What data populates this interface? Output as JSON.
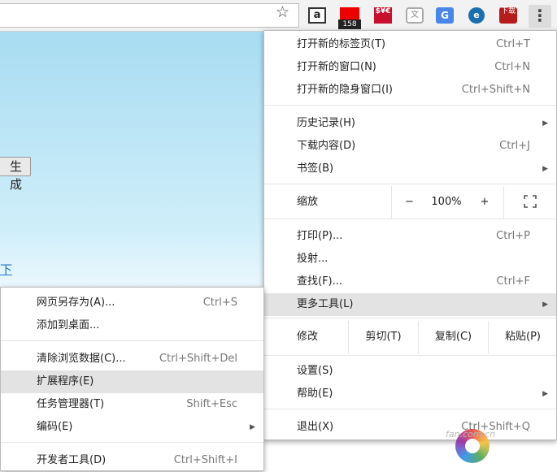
{
  "toolbar": {
    "star_icon": "star-icon",
    "extensions": [
      {
        "name": "amazon-icon",
        "glyph": "a"
      },
      {
        "name": "red-flag-icon",
        "badge": "158"
      },
      {
        "name": "currency-exchange-icon",
        "glyph": "$¥€"
      },
      {
        "name": "shield-icon",
        "glyph": "文"
      },
      {
        "name": "translate-icon",
        "glyph": "G"
      },
      {
        "name": "e-icon",
        "glyph": "e"
      },
      {
        "name": "tv-download-icon",
        "glyph": "下载"
      }
    ],
    "menu_glyph": "⋮"
  },
  "page": {
    "button_text": "生 成",
    "link_text": "下"
  },
  "main_menu": {
    "new_tab": {
      "label": "打开新的标签页(T)",
      "shortcut": "Ctrl+T"
    },
    "new_window": {
      "label": "打开新的窗口(N)",
      "shortcut": "Ctrl+N"
    },
    "incognito": {
      "label": "打开新的隐身窗口(I)",
      "shortcut": "Ctrl+Shift+N"
    },
    "history": {
      "label": "历史记录(H)"
    },
    "downloads": {
      "label": "下载内容(D)",
      "shortcut": "Ctrl+J"
    },
    "bookmarks": {
      "label": "书签(B)"
    },
    "zoom": {
      "label": "缩放",
      "minus": "−",
      "value": "100%",
      "plus": "+"
    },
    "print": {
      "label": "打印(P)...",
      "shortcut": "Ctrl+P"
    },
    "cast": {
      "label": "投射..."
    },
    "find": {
      "label": "查找(F)...",
      "shortcut": "Ctrl+F"
    },
    "more_tools": {
      "label": "更多工具(L)"
    },
    "edit": {
      "label": "修改",
      "cut": "剪切(T)",
      "copy": "复制(C)",
      "paste": "粘贴(P)"
    },
    "settings": {
      "label": "设置(S)"
    },
    "help": {
      "label": "帮助(E)"
    },
    "exit": {
      "label": "退出(X)",
      "shortcut": "Ctrl+Shift+Q"
    }
  },
  "sub_menu": {
    "save_as": {
      "label": "网页另存为(A)...",
      "shortcut": "Ctrl+S"
    },
    "add_desktop": {
      "label": "添加到桌面..."
    },
    "clear_data": {
      "label": "清除浏览数据(C)...",
      "shortcut": "Ctrl+Shift+Del"
    },
    "extensions": {
      "label": "扩展程序(E)"
    },
    "task_manager": {
      "label": "任务管理器(T)",
      "shortcut": "Shift+Esc"
    },
    "encoding": {
      "label": "编码(E)"
    },
    "devtools": {
      "label": "开发者工具(D)",
      "shortcut": "Ctrl+Shift+I"
    }
  },
  "watermark": {
    "text": "fan.com.cn"
  }
}
